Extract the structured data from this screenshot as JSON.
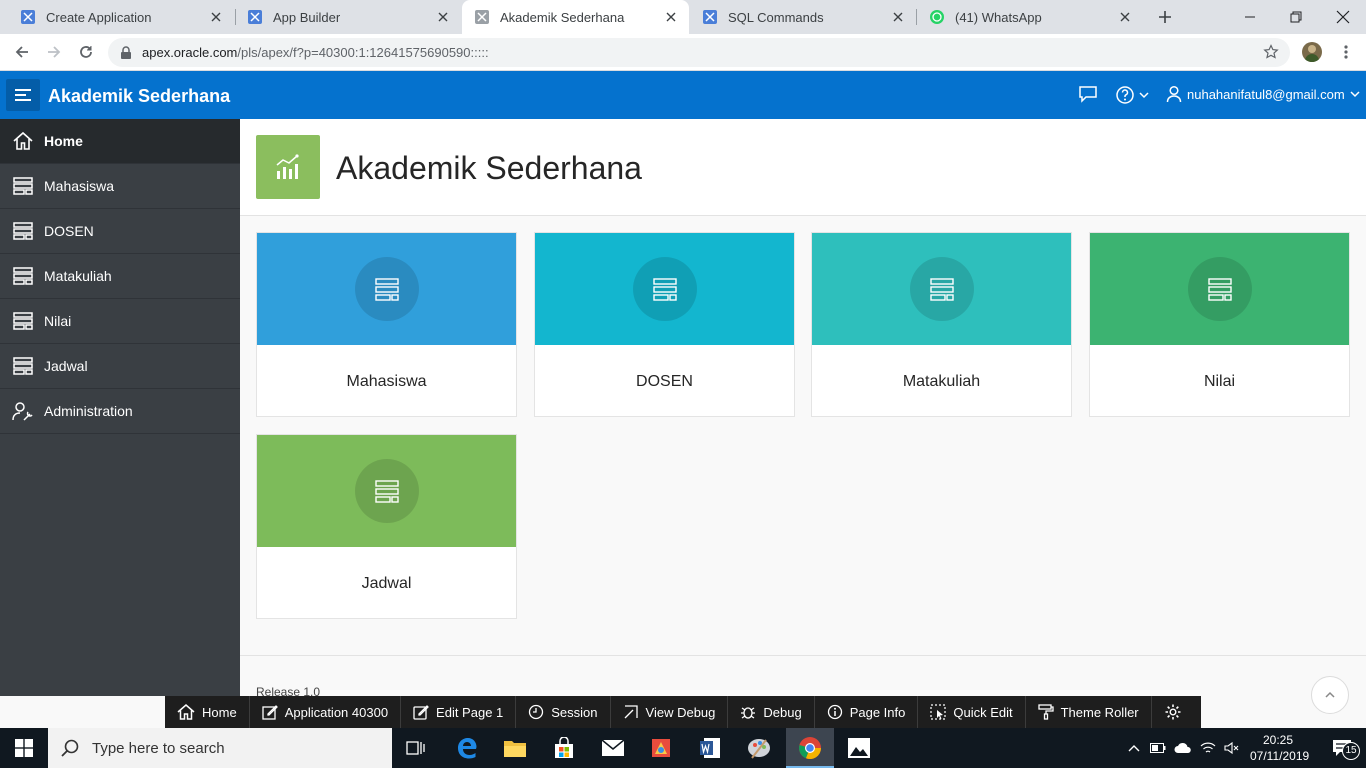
{
  "browser": {
    "tabs": [
      {
        "title": "Create Application",
        "icon": "apex-icon",
        "active": false
      },
      {
        "title": "App Builder",
        "icon": "apex-icon",
        "active": false
      },
      {
        "title": "Akademik Sederhana",
        "icon": "apex-icon",
        "active": true
      },
      {
        "title": "SQL Commands",
        "icon": "apex-icon",
        "active": false
      },
      {
        "title": "(41) WhatsApp",
        "icon": "whatsapp-icon",
        "active": false
      }
    ],
    "url_host": "apex.oracle.com",
    "url_path": "/pls/apex/f?p=40300:1:12641575690590:::::"
  },
  "app": {
    "title": "Akademik Sederhana",
    "user": "nuhahanifatul8@gmail.com",
    "brand_color": "#0572ce"
  },
  "sidebar": {
    "items": [
      {
        "label": "Home",
        "icon": "home-icon",
        "active": true
      },
      {
        "label": "Mahasiswa",
        "icon": "table-icon",
        "active": false
      },
      {
        "label": "DOSEN",
        "icon": "table-icon",
        "active": false
      },
      {
        "label": "Matakuliah",
        "icon": "table-icon",
        "active": false
      },
      {
        "label": "Nilai",
        "icon": "table-icon",
        "active": false
      },
      {
        "label": "Jadwal",
        "icon": "table-icon",
        "active": false
      },
      {
        "label": "Administration",
        "icon": "user-wrench-icon",
        "active": false
      }
    ]
  },
  "main": {
    "title": "Akademik Sederhana",
    "cards": [
      {
        "label": "Mahasiswa",
        "color": "#309fdb"
      },
      {
        "label": "DOSEN",
        "color": "#13b6cf"
      },
      {
        "label": "Matakuliah",
        "color": "#2ebfbc"
      },
      {
        "label": "Nilai",
        "color": "#3cb371"
      },
      {
        "label": "Jadwal",
        "color": "#7dbb5a"
      }
    ],
    "release": "Release 1.0"
  },
  "devtoolbar": {
    "items": [
      {
        "label": "Home",
        "icon": "home-icon"
      },
      {
        "label": "Application 40300",
        "icon": "edit-icon"
      },
      {
        "label": "Edit Page 1",
        "icon": "edit-icon"
      },
      {
        "label": "Session",
        "icon": "clock-icon"
      },
      {
        "label": "View Debug",
        "icon": "view-debug-icon"
      },
      {
        "label": "Debug",
        "icon": "bug-icon"
      },
      {
        "label": "Page Info",
        "icon": "info-icon"
      },
      {
        "label": "Quick Edit",
        "icon": "quick-edit-icon"
      },
      {
        "label": "Theme Roller",
        "icon": "paint-roller-icon"
      }
    ]
  },
  "taskbar": {
    "search_placeholder": "Type here to search",
    "time": "20:25",
    "date": "07/11/2019",
    "notifications": "15"
  }
}
